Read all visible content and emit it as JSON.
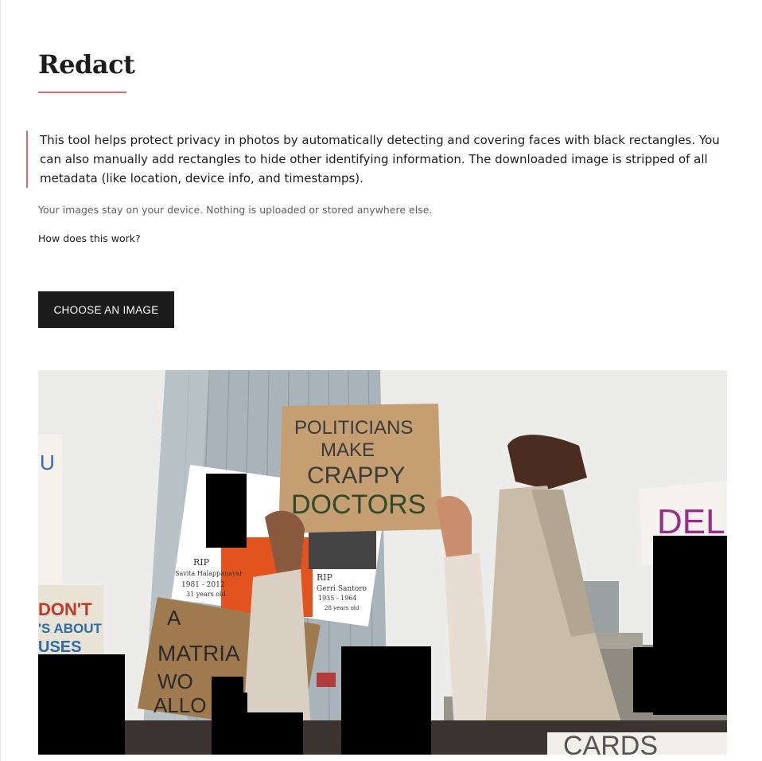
{
  "page": {
    "title": "Redact",
    "accent_color": "#e4686a",
    "intro": "This tool helps protect privacy in photos by automatically detecting and covering faces with black rectangles. You can also manually add rectangles to hide other identifying information. The downloaded image is stripped of all metadata (like location, device info, and timestamps).",
    "privacy_note": "Your images stay on your device. Nothing is uploaded or stored anywhere else.",
    "how_link": "How does this work?",
    "choose_button": "CHOOSE AN IMAGE"
  },
  "photo": {
    "signs": {
      "politicians": [
        "POLITICIANS",
        "MAKE",
        "CRAPPY",
        "DOCTORS"
      ],
      "matriarch": [
        "A",
        "MATRIA",
        "WO",
        "ALLO"
      ],
      "left_sign": [
        "DON'T",
        "'S ABOUT",
        "USES"
      ],
      "right_sign": "DELET",
      "memorial_left": [
        "RIP",
        "Savita Halappanavar",
        "1981 - 2012",
        "31 years old"
      ],
      "memorial_right": [
        "RIP",
        "Gerri Santoro",
        "1935 - 1964",
        "28 years old"
      ],
      "bottom_sign": "CARDS"
    },
    "redaction_color": "#000000"
  }
}
